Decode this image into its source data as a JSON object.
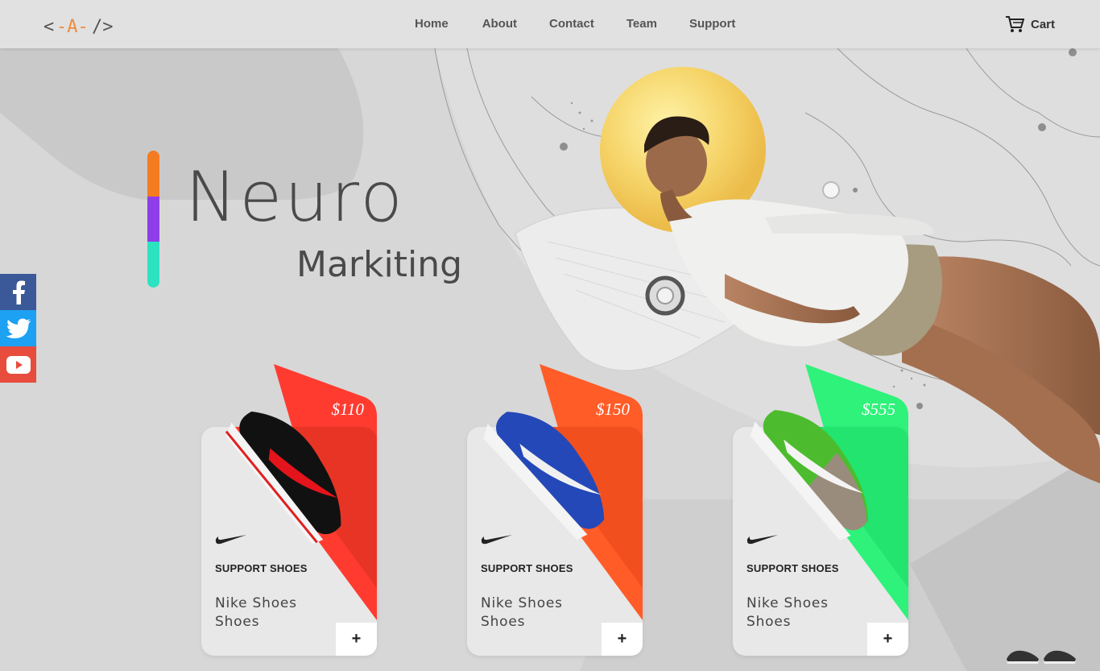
{
  "nav": {
    "logo_text": "<-A-/>",
    "links": [
      "Home",
      "About",
      "Contact",
      "Team",
      "Support"
    ],
    "cart_label": "Cart"
  },
  "hero": {
    "title": "Neuro",
    "subtitle": "Markiting",
    "accent_colors": [
      "#f47c20",
      "#8e3ee8",
      "#2de2c0"
    ]
  },
  "social": [
    {
      "icon": "facebook-icon",
      "color": "#3b5998"
    },
    {
      "icon": "twitter-icon",
      "color": "#1da1f2"
    },
    {
      "icon": "youtube-icon",
      "color": "#e74c3c"
    }
  ],
  "products": [
    {
      "price": "$110",
      "category": "SUPPORT SHOES",
      "name": "Nike Shoes Shoes",
      "accent": "#ff3b30",
      "shoe_color": "black-red",
      "add_label": "+"
    },
    {
      "price": "$150",
      "category": "SUPPORT SHOES",
      "name": "Nike Shoes Shoes",
      "accent": "#ff5c28",
      "shoe_color": "blue",
      "add_label": "+"
    },
    {
      "price": "$555",
      "category": "SUPPORT SHOES",
      "name": "Nike Shoes Shoes",
      "accent": "#2ef27a",
      "shoe_color": "green",
      "add_label": "+"
    }
  ]
}
